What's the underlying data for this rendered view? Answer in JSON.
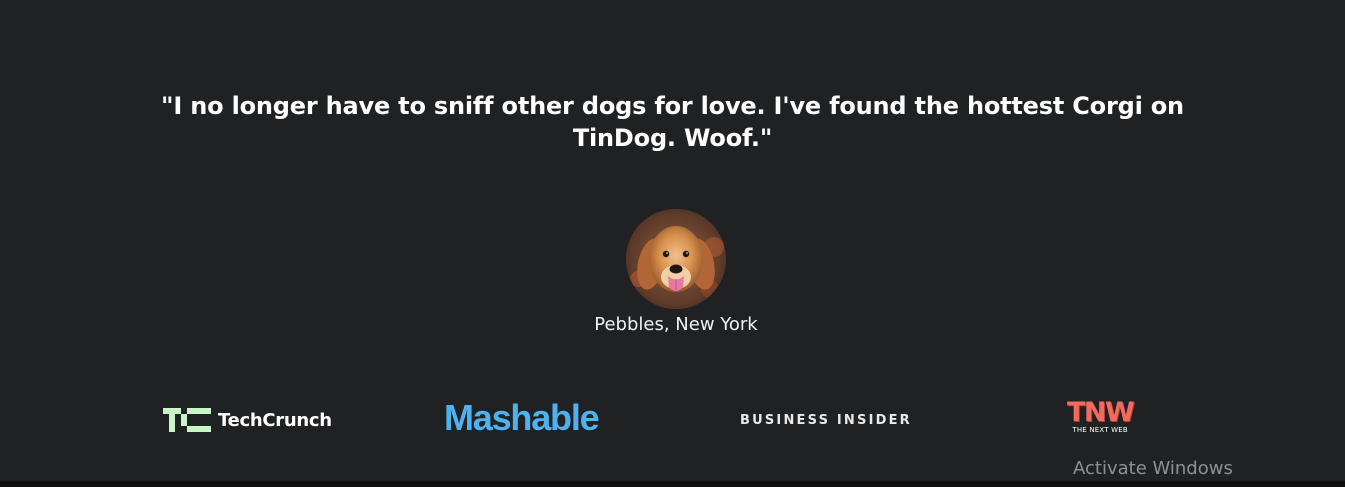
{
  "testimonial": {
    "quote": "\"I no longer have to sniff other dogs for love. I've found the hottest Corgi on TinDog. Woof.\"",
    "author": "Pebbles, New York",
    "avatar_icon": "dog-avatar-icon"
  },
  "press": {
    "techcrunch": "TechCrunch",
    "mashable": "Mashable",
    "business_insider": "BUSINESS INSIDER",
    "tnw_mark": "TNW",
    "tnw_sub": "THE NEXT WEB"
  },
  "system": {
    "watermark": "Activate Windows"
  },
  "colors": {
    "background": "#202123",
    "text": "#ffffff",
    "techcrunch": "#c7f5c3",
    "mashable": "#4fb2f0",
    "tnw": "#f36b5f"
  }
}
